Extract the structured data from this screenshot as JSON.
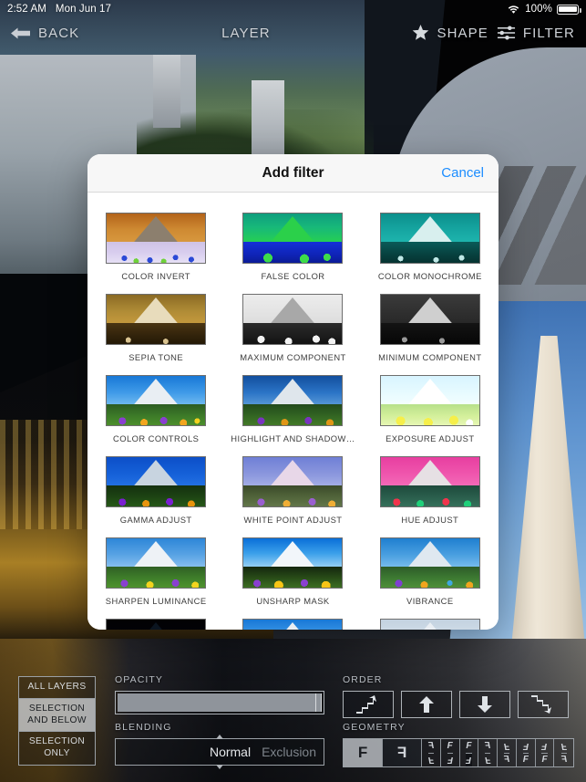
{
  "status_bar": {
    "time": "2:52 AM",
    "date": "Mon Jun 17",
    "wifi_icon": "wifi-icon",
    "battery_percent": "100%",
    "battery_icon": "battery-full-icon"
  },
  "nav_bar": {
    "back_icon": "arrow-left-icon",
    "back_label": "BACK",
    "title": "LAYER",
    "shape_icon": "star-icon",
    "shape_label": "SHAPE",
    "filter_icon": "sliders-icon",
    "filter_label": "FILTER"
  },
  "dialog": {
    "title": "Add filter",
    "cancel_label": "Cancel",
    "accent_color": "#1a8cff",
    "filters": [
      {
        "label": "COLOR INVERT",
        "style": "invert"
      },
      {
        "label": "FALSE COLOR",
        "style": "false-color"
      },
      {
        "label": "COLOR MONOCHROME",
        "style": "mono-teal"
      },
      {
        "label": "SEPIA TONE",
        "style": "sepia"
      },
      {
        "label": "MAXIMUM COMPONENT",
        "style": "max-comp"
      },
      {
        "label": "MINIMUM COMPONENT",
        "style": "min-comp"
      },
      {
        "label": "COLOR CONTROLS",
        "style": "normal"
      },
      {
        "label": "HIGHLIGHT AND SHADOW…",
        "style": "normal-dark"
      },
      {
        "label": "EXPOSURE ADJUST",
        "style": "bright"
      },
      {
        "label": "GAMMA ADJUST",
        "style": "gamma"
      },
      {
        "label": "WHITE POINT ADJUST",
        "style": "whitepoint"
      },
      {
        "label": "HUE ADJUST",
        "style": "hue-pink"
      },
      {
        "label": "SHARPEN LUMINANCE",
        "style": "sharpen"
      },
      {
        "label": "UNSHARP MASK",
        "style": "unsharp"
      },
      {
        "label": "VIBRANCE",
        "style": "vibrance"
      },
      {
        "label": "",
        "style": "dark-glow"
      },
      {
        "label": "",
        "style": "normal"
      },
      {
        "label": "",
        "style": "washed"
      }
    ]
  },
  "toolbar": {
    "scope": {
      "options": [
        "ALL\nLAYERS",
        "SELECTION\nAND BELOW",
        "SELECTION\nONLY"
      ],
      "option_1": "ALL LAYERS",
      "option_2": "SELECTION AND BELOW",
      "option_3": "SELECTION ONLY",
      "selected_index": 1
    },
    "opacity": {
      "label": "OPACITY",
      "value_percent": 100
    },
    "blending": {
      "label": "BLENDING",
      "selected": "Normal",
      "next": "Exclusion"
    },
    "order": {
      "label": "ORDER",
      "buttons": [
        {
          "name": "send-to-front",
          "icon": "arrow-up-stairs-icon",
          "active": true
        },
        {
          "name": "move-up",
          "icon": "arrow-up-icon",
          "active": false
        },
        {
          "name": "move-down",
          "icon": "arrow-down-icon",
          "active": false
        },
        {
          "name": "send-to-back",
          "icon": "arrow-down-stairs-icon",
          "active": false
        }
      ]
    },
    "geometry": {
      "label": "GEOMETRY",
      "primary": "F",
      "mirrored": "F",
      "grid_glyph": "F",
      "selected_index": 0
    }
  }
}
